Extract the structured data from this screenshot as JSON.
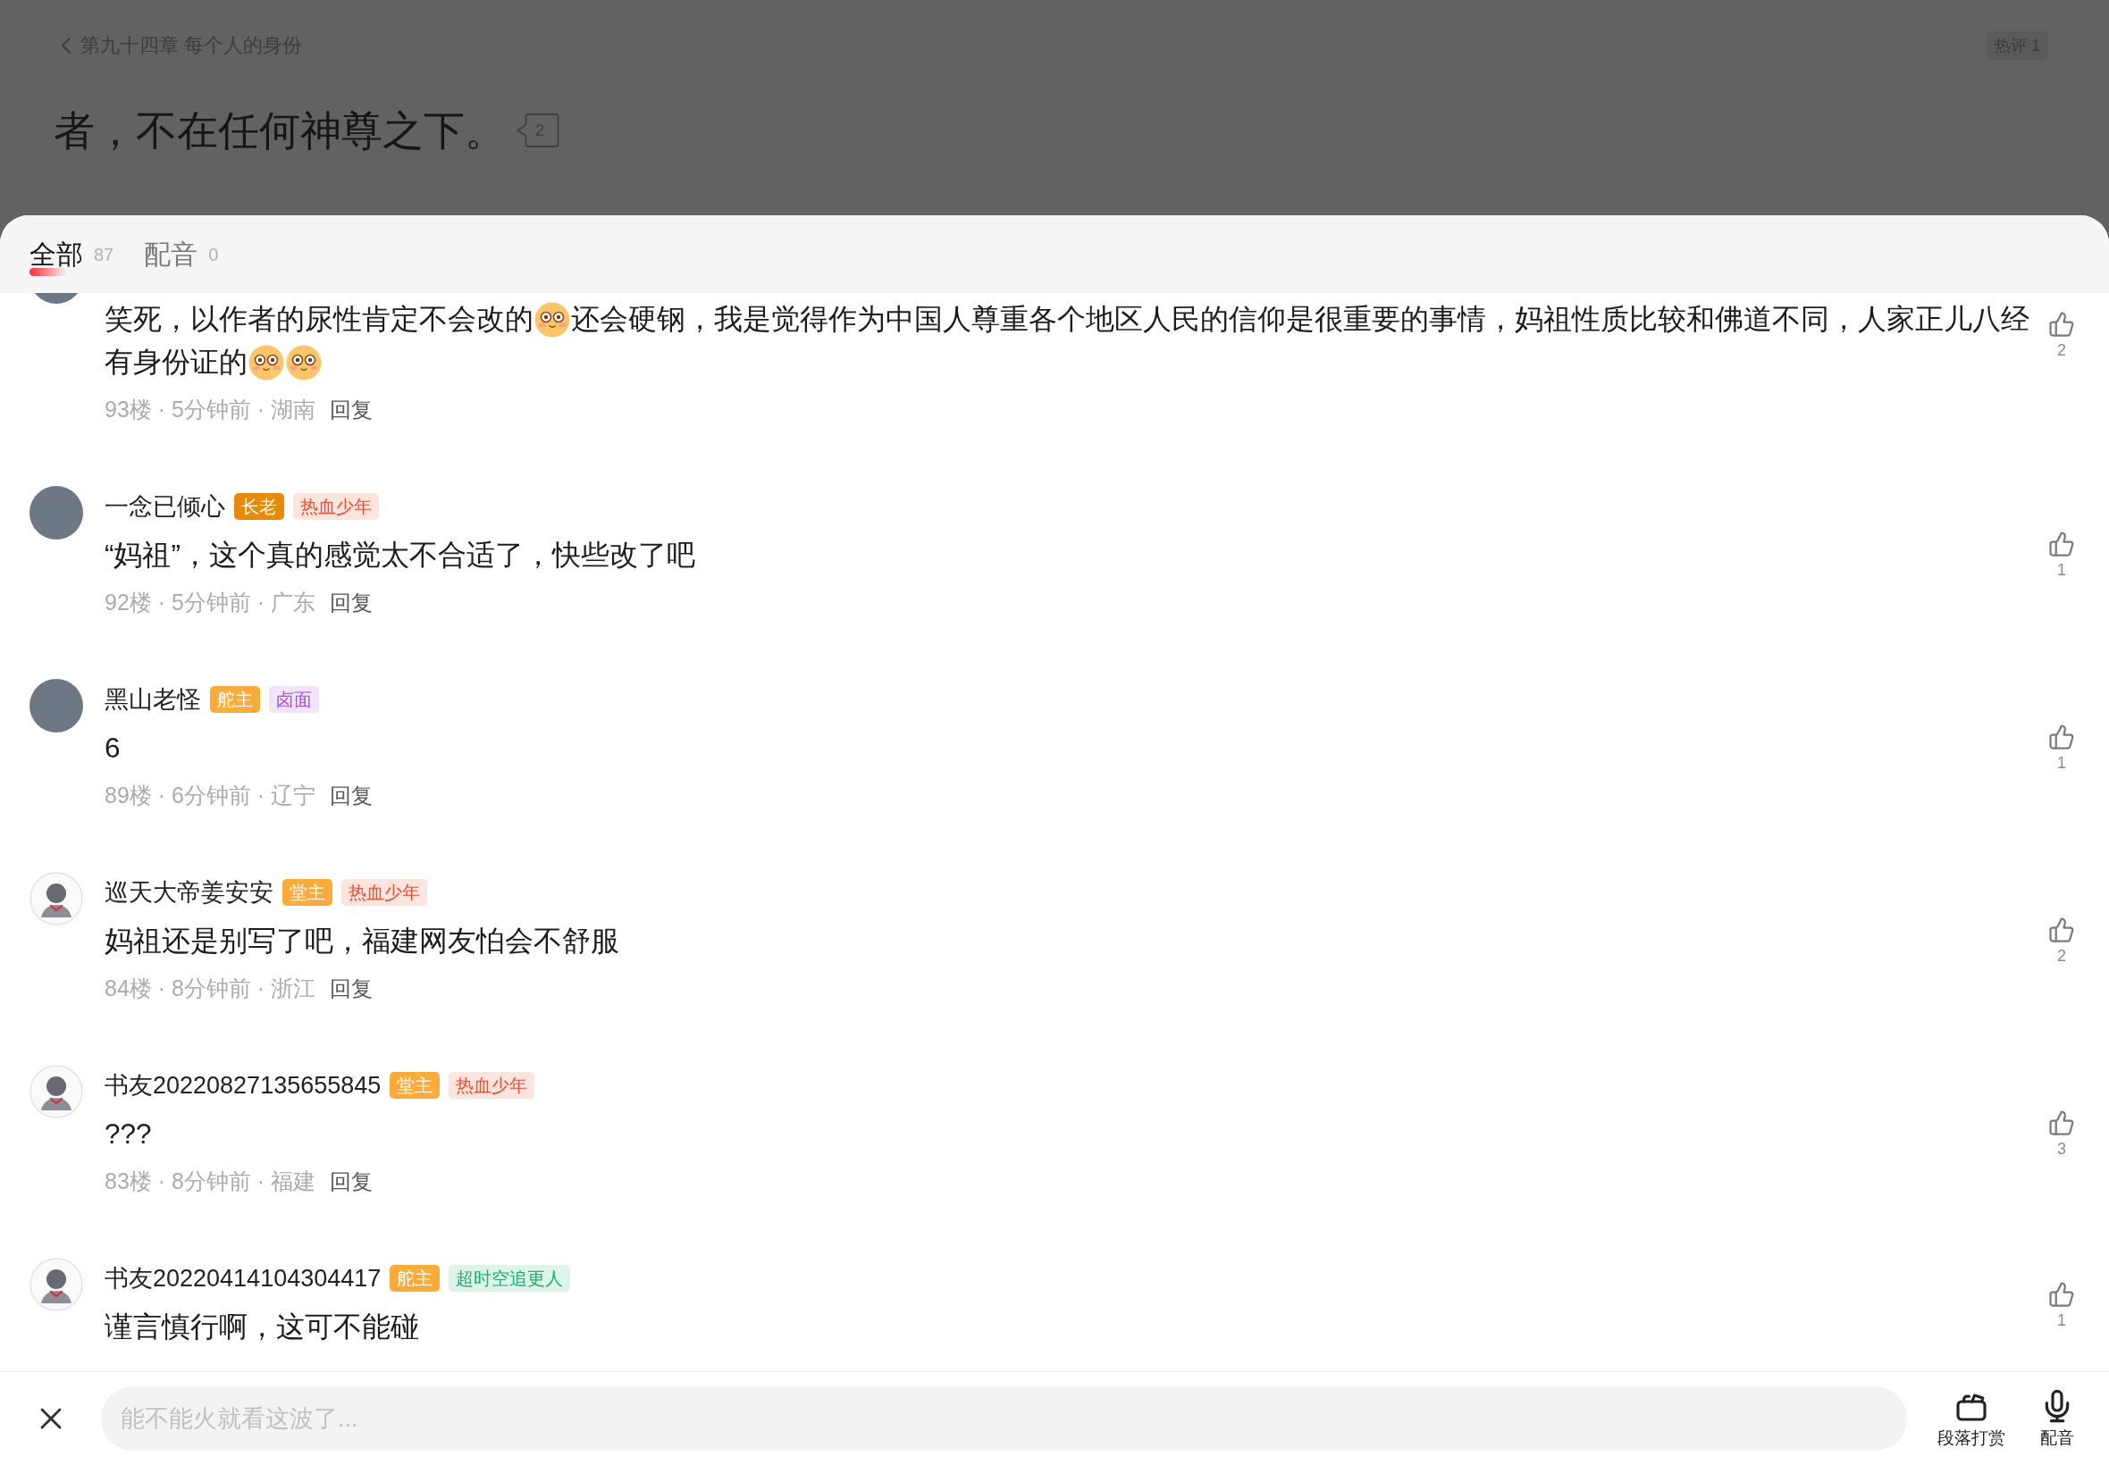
{
  "reader": {
    "back_link": "第九十四章 每个人的身份",
    "hot_comments": "热评 1",
    "paragraph": "者，不在任何神尊之下。",
    "paragraph_comments": "2"
  },
  "tabs": [
    {
      "label": "全部",
      "count": "87",
      "selected": true
    },
    {
      "label": "配音",
      "count": "0",
      "selected": false
    }
  ],
  "comments": [
    {
      "avatar": {
        "kind": "photo"
      },
      "parts": [
        {
          "kind": "text",
          "text": "笑死，以作者的尿性肯定不会改的"
        },
        {
          "kind": "emoji"
        },
        {
          "kind": "text",
          "text": "还会硬钢，我是觉得作为中国人尊重各个地区人民的信仰是很重要的事情，妈祖性质比较和佛道不同，人家正儿八经有身份证的"
        },
        {
          "kind": "emoji"
        },
        {
          "kind": "emoji"
        }
      ],
      "meta": "93楼 · 5分钟前 · 湖南",
      "reply": "回复",
      "likes": "2"
    },
    {
      "avatar": {
        "kind": "photo"
      },
      "name": "一念已倾心",
      "badges": [
        {
          "text": "长老",
          "kind": "solid",
          "color": "#e8890c"
        },
        {
          "text": "热血少年",
          "kind": "soft",
          "color": "#ee4b2b"
        }
      ],
      "parts": [
        {
          "kind": "text",
          "text": "“妈祖”，这个真的感觉太不合适了，快些改了吧"
        }
      ],
      "meta": "92楼 · 5分钟前 · 广东",
      "reply": "回复",
      "likes": "1"
    },
    {
      "avatar": {
        "kind": "photo"
      },
      "name": "黑山老怪",
      "badges": [
        {
          "text": "舵主",
          "kind": "solid",
          "color": "#fbab3a"
        },
        {
          "text": "卤面",
          "kind": "soft",
          "color": "#a64fe0"
        }
      ],
      "parts": [
        {
          "kind": "text",
          "text": "6"
        }
      ],
      "meta": "89楼 · 6分钟前 · 辽宁",
      "reply": "回复",
      "likes": "1"
    },
    {
      "avatar": {
        "kind": "default"
      },
      "name": "巡天大帝姜安安",
      "badges": [
        {
          "text": "堂主",
          "kind": "solid",
          "color": "#fbab3a"
        },
        {
          "text": "热血少年",
          "kind": "soft",
          "color": "#ee4b2b"
        }
      ],
      "parts": [
        {
          "kind": "text",
          "text": "妈祖还是别写了吧，福建网友怕会不舒服"
        }
      ],
      "meta": "84楼 · 8分钟前 · 浙江",
      "reply": "回复",
      "likes": "2"
    },
    {
      "avatar": {
        "kind": "default"
      },
      "name": "书友20220827135655845",
      "badges": [
        {
          "text": "堂主",
          "kind": "solid",
          "color": "#fbab3a"
        },
        {
          "text": "热血少年",
          "kind": "soft",
          "color": "#ee4b2b"
        }
      ],
      "parts": [
        {
          "kind": "text",
          "text": "???"
        }
      ],
      "meta": "83楼 · 8分钟前 · 福建",
      "reply": "回复",
      "likes": "3"
    },
    {
      "avatar": {
        "kind": "default"
      },
      "name": "书友20220414104304417",
      "badges": [
        {
          "text": "舵主",
          "kind": "solid",
          "color": "#fbab3a"
        },
        {
          "text": "超时空追更人",
          "kind": "soft",
          "color": "#1fae6b"
        }
      ],
      "parts": [
        {
          "kind": "text",
          "text": "谨言慎行啊，这可不能碰"
        }
      ],
      "likes": "1"
    }
  ],
  "composer": {
    "placeholder": "能不能火就看这波了...",
    "actions": [
      {
        "kind": "tip",
        "label": "段落打赏"
      },
      {
        "kind": "voice",
        "label": "配音"
      }
    ]
  }
}
